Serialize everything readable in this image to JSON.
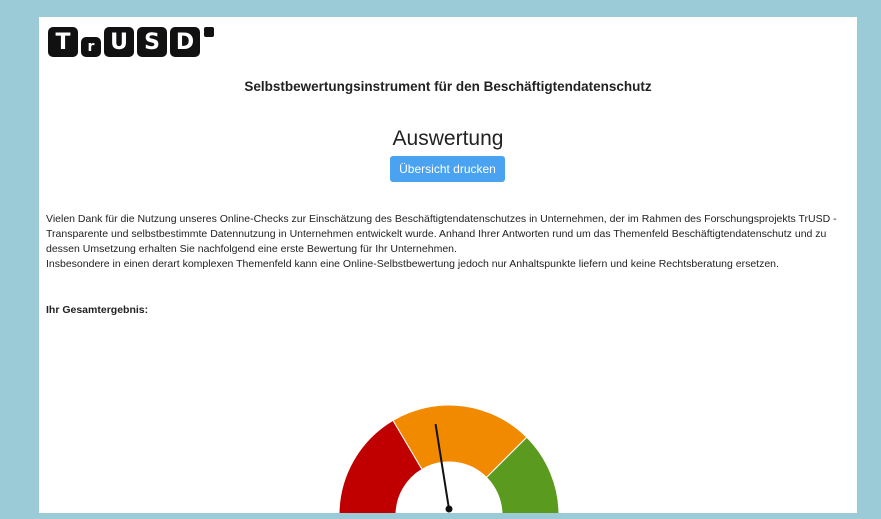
{
  "logo": {
    "letters": [
      "T",
      "r",
      "U",
      "S",
      "D"
    ]
  },
  "header": {
    "subtitle": "Selbstbewertungsinstrument für den Beschäftigtendatenschutz"
  },
  "main": {
    "title": "Auswertung",
    "print_button_label": "Übersicht drucken",
    "intro_paragraph_1": "Vielen Dank für die Nutzung unseres Online-Checks zur Einschätzung des Beschäftigtendatenschutzes in Unternehmen, der im Rahmen des Forschungsprojekts TrUSD - Transparente und selbstbestimmte Datennutzung in Unternehmen entwickelt wurde. Anhand Ihrer Antworten rund um das Themenfeld Beschäftigtendatenschutz und zu dessen Umsetzung erhalten Sie nachfolgend eine erste Bewertung für Ihr Unternehmen.",
    "intro_paragraph_2": "Insbesondere in einen derart komplexen Themenfeld kann eine Online-Selbstbewertung jedoch nur Anhaltspunkte liefern und keine Rechtsberatung ersetzen.",
    "result_label": "Ihr Gesamtergebnis:"
  },
  "gauge": {
    "zones": [
      {
        "name": "red",
        "from": 0,
        "to": 0.33,
        "color": "#c00000"
      },
      {
        "name": "orange",
        "from": 0.33,
        "to": 0.75,
        "color": "#f28a00"
      },
      {
        "name": "green",
        "from": 0.75,
        "to": 1,
        "color": "#5a9a1e"
      }
    ],
    "needle_value": 0.45,
    "needle_color": "#111111"
  },
  "colors": {
    "background": "#9ccbd8",
    "panel": "#ffffff",
    "button": "#4aa3f0"
  }
}
